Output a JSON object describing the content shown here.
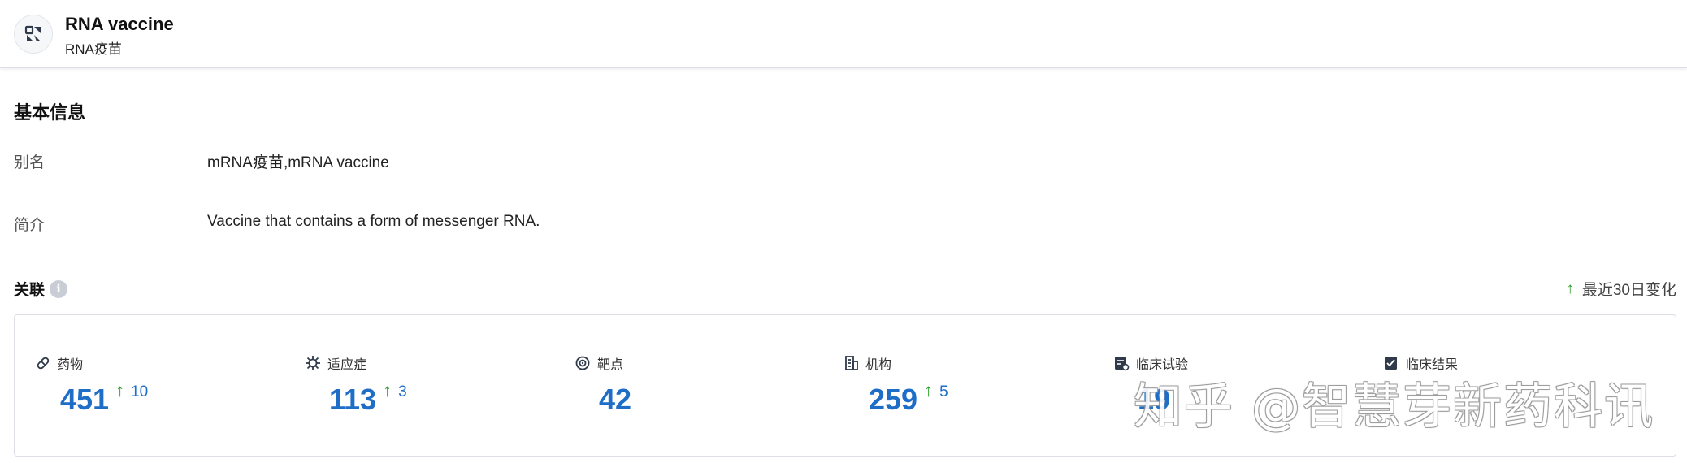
{
  "header": {
    "title": "RNA vaccine",
    "subtitle": "RNA疫苗",
    "logo_icon": "vaccine-icon"
  },
  "basic_info": {
    "title": "基本信息",
    "fields": [
      {
        "label": "别名",
        "value": "mRNA疫苗,mRNA vaccine"
      },
      {
        "label": "简介",
        "value": "Vaccine that contains a form of messenger RNA."
      }
    ]
  },
  "relations": {
    "title": "关联",
    "info_icon": "info-icon",
    "legend_arrow": "↑",
    "legend_label": "最近30日变化",
    "stats": [
      {
        "icon": "pill-icon",
        "label": "药物",
        "value": "451",
        "arrow": "↑",
        "delta": "10"
      },
      {
        "icon": "virus-icon",
        "label": "适应症",
        "value": "113",
        "arrow": "↑",
        "delta": "3"
      },
      {
        "icon": "target-icon",
        "label": "靶点",
        "value": "42",
        "arrow": "",
        "delta": ""
      },
      {
        "icon": "building-icon",
        "label": "机构",
        "value": "259",
        "arrow": "↑",
        "delta": "5"
      },
      {
        "icon": "clinical-trial-icon",
        "label": "临床试验",
        "value": "19",
        "arrow": "",
        "delta": ""
      },
      {
        "icon": "clinical-result-icon",
        "label": "临床结果",
        "value": "",
        "arrow": "",
        "delta": ""
      }
    ],
    "accent_color": "#1e6ec8",
    "arrow_color": "#2ea12e"
  },
  "watermark": "知乎 @智慧芽新药科讯"
}
